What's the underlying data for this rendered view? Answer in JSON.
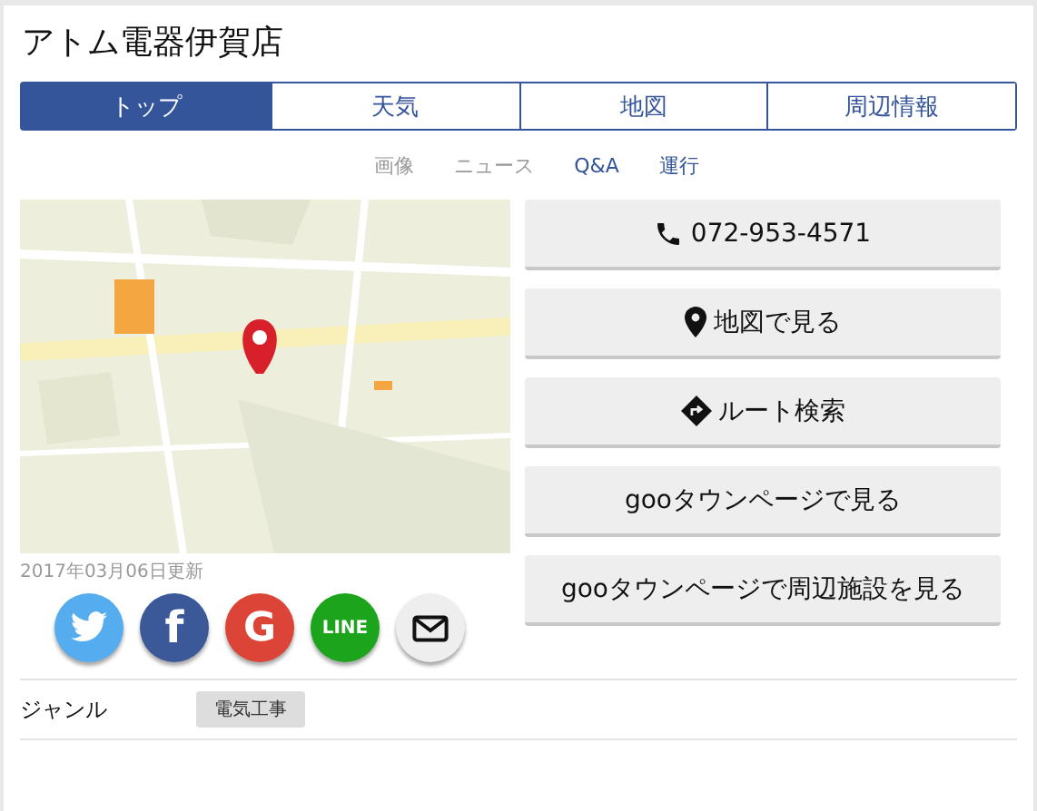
{
  "title": "アトム電器伊賀店",
  "tabs": [
    {
      "label": "トップ",
      "selected": true
    },
    {
      "label": "天気",
      "selected": false
    },
    {
      "label": "地図",
      "selected": false
    },
    {
      "label": "周辺情報",
      "selected": false
    }
  ],
  "sub_links": [
    {
      "label": "画像",
      "disabled": true
    },
    {
      "label": "ニュース",
      "disabled": true
    },
    {
      "label": "Q&A",
      "disabled": false
    },
    {
      "label": "運行",
      "disabled": false
    }
  ],
  "updated": "2017年03月06日更新",
  "actions": [
    {
      "kind": "phone",
      "label": "072-953-4571"
    },
    {
      "kind": "pin",
      "label": "地図で見る"
    },
    {
      "kind": "route",
      "label": "ルート検索"
    },
    {
      "kind": "plain",
      "label": "gooタウンページで見る"
    },
    {
      "kind": "plain",
      "label": "gooタウンページで周辺施設を見る"
    }
  ],
  "share": [
    {
      "kind": "twitter"
    },
    {
      "kind": "facebook",
      "label": "f"
    },
    {
      "kind": "google",
      "label": "G"
    },
    {
      "kind": "line",
      "label": "LINE"
    },
    {
      "kind": "mail"
    }
  ],
  "genre": {
    "label": "ジャンル",
    "tag": "電気工事"
  }
}
